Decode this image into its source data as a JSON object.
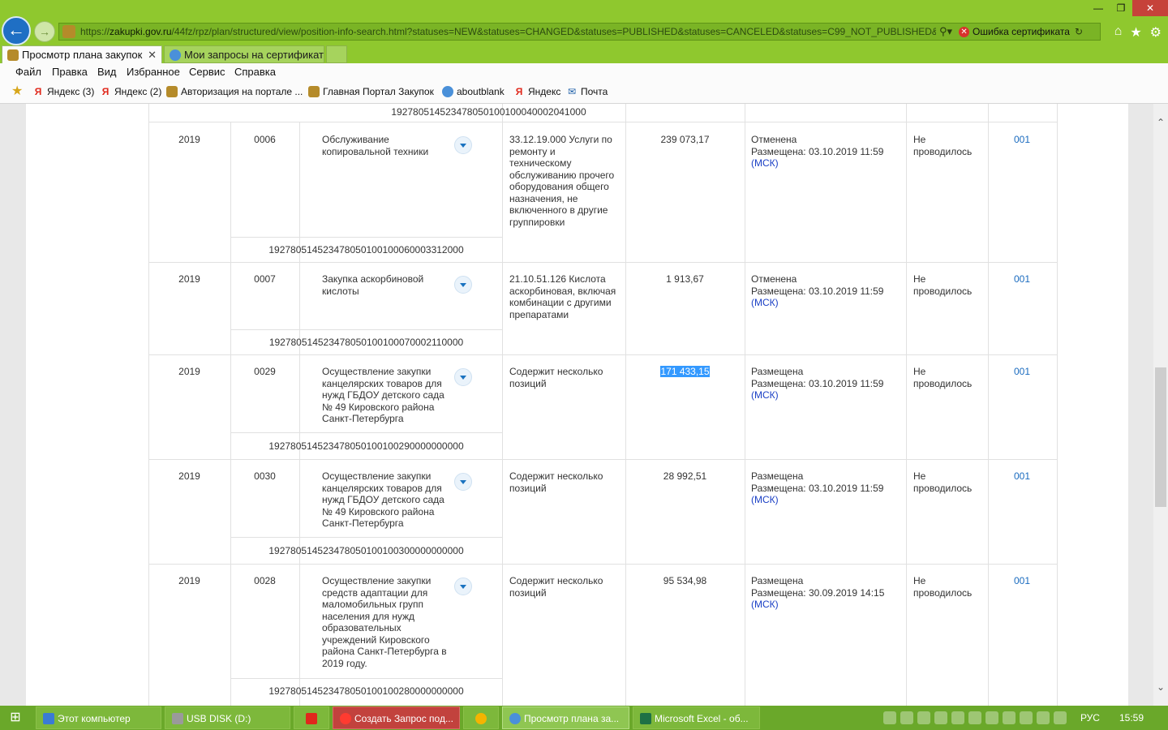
{
  "browser": {
    "url_prefix": "https://",
    "url_domain": "zakupki.gov.ru",
    "url_path": "/44fz/rpz/plan/structured/view/position-info-search.html?statuses=NEW&statuses=CHANGED&statuses=PUBLISHED&statuses=CANCELED&statuses=C99_NOT_PUBLISHED&pla",
    "cert_error": "Ошибка сертификата",
    "tabs": [
      {
        "label": "Просмотр плана закупок",
        "active": true
      },
      {
        "label": "Мои запросы на сертификат",
        "active": false
      }
    ],
    "menu": [
      "Файл",
      "Правка",
      "Вид",
      "Избранное",
      "Сервис",
      "Справка"
    ],
    "favorites": [
      "Яндекс (3)",
      "Яндекс (2)",
      "Авторизация на портале ...",
      "Главная Портал Закупок",
      "aboutblank",
      "Яндекс",
      "Почта"
    ]
  },
  "table": {
    "top_reg": "192780514523478050100100040002041000",
    "rows": [
      {
        "year": "2019",
        "num": "0006",
        "name": "Обслуживание копировальной техники",
        "okpd": "33.12.19.000 Услуги по ремонту и техническому обслуживанию прочего оборудования общего назначения, не включенного в другие группировки",
        "sum": "239 073,17",
        "status": "Отменена",
        "placed": "Размещена: 03.10.2019 11:59",
        "tz": "(МСК)",
        "proc": "Не проводилось",
        "link": "001",
        "reg": "192780514523478050100100060003312000"
      },
      {
        "year": "2019",
        "num": "0007",
        "name": "Закупка аскорбиновой кислоты",
        "okpd": "21.10.51.126 Кислота аскорбиновая, включая комбинации с другими препаратами",
        "sum": "1 913,67",
        "status": "Отменена",
        "placed": "Размещена: 03.10.2019 11:59",
        "tz": "(МСК)",
        "proc": "Не проводилось",
        "link": "001",
        "reg": "192780514523478050100100070002110000"
      },
      {
        "year": "2019",
        "num": "0029",
        "name": "Осуществление закупки канцелярских товаров для нужд ГБДОУ детского сада № 49 Кировского района Санкт-Петербурга",
        "okpd": "Содержит несколько позиций",
        "sum": "171 433,15",
        "status": "Размещена",
        "placed": "Размещена: 03.10.2019 11:59",
        "tz": "(МСК)",
        "proc": "Не проводилось",
        "link": "001",
        "reg": "192780514523478050100100290000000000"
      },
      {
        "year": "2019",
        "num": "0030",
        "name": "Осуществление закупки канцелярских товаров для нужд ГБДОУ детского сада № 49 Кировского района Санкт-Петербурга",
        "okpd": "Содержит несколько позиций",
        "sum": "28 992,51",
        "status": "Размещена",
        "placed": "Размещена: 03.10.2019 11:59",
        "tz": "(МСК)",
        "proc": "Не проводилось",
        "link": "001",
        "reg": "192780514523478050100100300000000000"
      },
      {
        "year": "2019",
        "num": "0028",
        "name": "Осуществление закупки средств адаптации для маломобильных групп населения для нужд образовательных учреждений Кировского района Санкт-Петербурга в 2019 году.",
        "okpd": "Содержит несколько позиций",
        "sum": "95 534,98",
        "status": "Размещена",
        "placed": "Размещена: 30.09.2019 14:15",
        "tz": "(МСК)",
        "proc": "Не проводилось",
        "link": "001",
        "reg": "192780514523478050100100280000000000"
      }
    ]
  },
  "taskbar": {
    "items": [
      "Этот компьютер",
      "USB DISK (D:)",
      "Создать Запрос под...",
      "Просмотр плана за...",
      "Microsoft Excel - об..."
    ],
    "lang": "РУС",
    "time": "15:59"
  }
}
